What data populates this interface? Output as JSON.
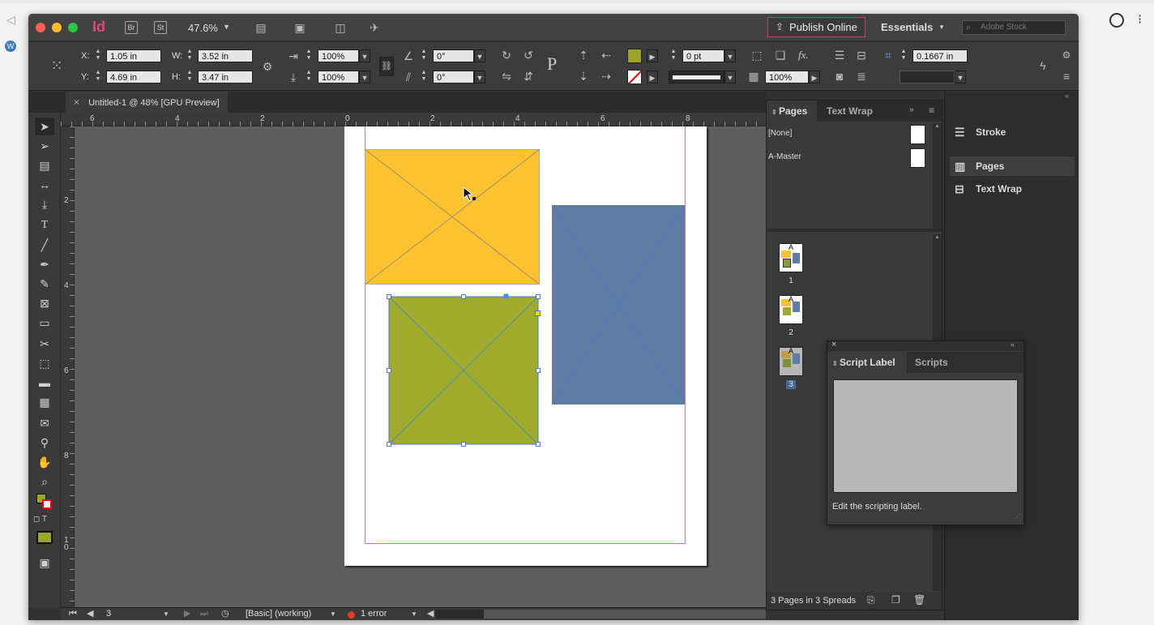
{
  "app": {
    "icon_label": "Id",
    "bridge_label": "Br",
    "stock_label": "St",
    "zoom": "47.6%",
    "publish_online": "Publish Online",
    "workspace": "Essentials",
    "search_placeholder": "Adobe Stock"
  },
  "control": {
    "x_label": "X:",
    "x_value": "1.05 in",
    "y_label": "Y:",
    "y_value": "4.69 in",
    "w_label": "W:",
    "w_value": "3.52 in",
    "h_label": "H:",
    "h_value": "3.47 in",
    "scale_x": "100%",
    "scale_y": "100%",
    "rotation": "0°",
    "shear": "0°",
    "stroke_weight": "0 pt",
    "opacity": "100%",
    "offset_value": "0.1667 in",
    "fill_color": "#9aa62a"
  },
  "document": {
    "tab_title": "Untitled-1 @ 48% [GPU Preview]",
    "close_glyph": "×",
    "h_ruler_labels": [
      "6",
      "4",
      "2",
      "0",
      "2",
      "4",
      "6",
      "8"
    ],
    "v_ruler_labels": [
      "2",
      "4",
      "6",
      "8",
      "1\n0"
    ],
    "frames": [
      {
        "name": "orange",
        "color": "#fcc22f",
        "selected": false
      },
      {
        "name": "blue",
        "color": "#5f7ca5",
        "selected": false
      },
      {
        "name": "green",
        "color": "#9fab2c",
        "selected": true
      }
    ]
  },
  "status": {
    "page": "3",
    "preflight_profile": "[Basic] (working)",
    "errors": "1 error"
  },
  "pages_panel": {
    "tab_pages": "Pages",
    "tab_textwrap": "Text Wrap",
    "masters": [
      "[None]",
      "A-Master"
    ],
    "pages": [
      "1",
      "2",
      "3"
    ],
    "master_letter": "A",
    "footer": "3 Pages in 3 Spreads"
  },
  "right_column": {
    "items": [
      "Stroke",
      "Pages",
      "Text Wrap"
    ]
  },
  "script_panel": {
    "tab_label": "Script Label",
    "tab_scripts": "Scripts",
    "hint": "Edit the scripting label."
  }
}
